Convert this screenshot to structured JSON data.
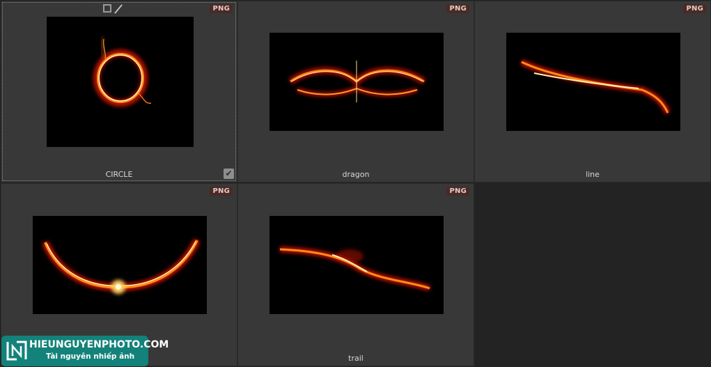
{
  "items": [
    {
      "name": "CIRCLE",
      "badge": "PNG"
    },
    {
      "name": "dragon",
      "badge": "PNG"
    },
    {
      "name": "line",
      "badge": "PNG"
    },
    {
      "name": "",
      "badge": "PNG"
    },
    {
      "name": "trail",
      "badge": "PNG"
    }
  ],
  "watermark": {
    "title": "HIEUNGUYENPHOTO.COM",
    "subtitle": "Tài nguyên nhiếp ảnh"
  },
  "colors": {
    "fire_core": "#fff2b0",
    "fire_mid": "#ff8a1a",
    "fire_outer": "#c81800",
    "badge_bg": "#4a2a26",
    "watermark_bg": "#13827a"
  }
}
